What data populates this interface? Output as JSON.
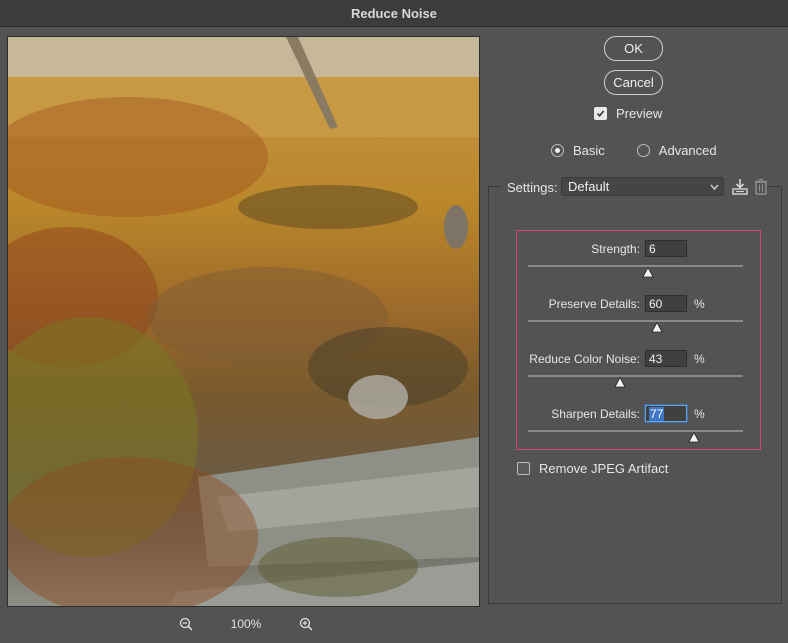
{
  "window": {
    "title": "Reduce Noise"
  },
  "zoom": {
    "level": "100%"
  },
  "buttons": {
    "ok": "OK",
    "cancel": "Cancel"
  },
  "preview": {
    "label": "Preview",
    "checked": true
  },
  "mode": {
    "basic": "Basic",
    "advanced": "Advanced",
    "selected": "basic"
  },
  "settings": {
    "label": "Settings:",
    "value": "Default"
  },
  "params": [
    {
      "label": "Strength:",
      "value": "6",
      "unit": "",
      "fraction": 0.56
    },
    {
      "label": "Preserve Details:",
      "value": "60",
      "unit": "%",
      "fraction": 0.6
    },
    {
      "label": "Reduce Color Noise:",
      "value": "43",
      "unit": "%",
      "fraction": 0.43
    },
    {
      "label": "Sharpen Details:",
      "value": "77",
      "unit": "%",
      "fraction": 0.77
    }
  ],
  "jpeg": {
    "label": "Remove JPEG Artifact",
    "checked": false
  },
  "icons": {
    "zoom_out": "zoom-out-icon",
    "zoom_in": "zoom-in-icon",
    "save": "save-settings-icon",
    "delete": "trash-icon"
  }
}
